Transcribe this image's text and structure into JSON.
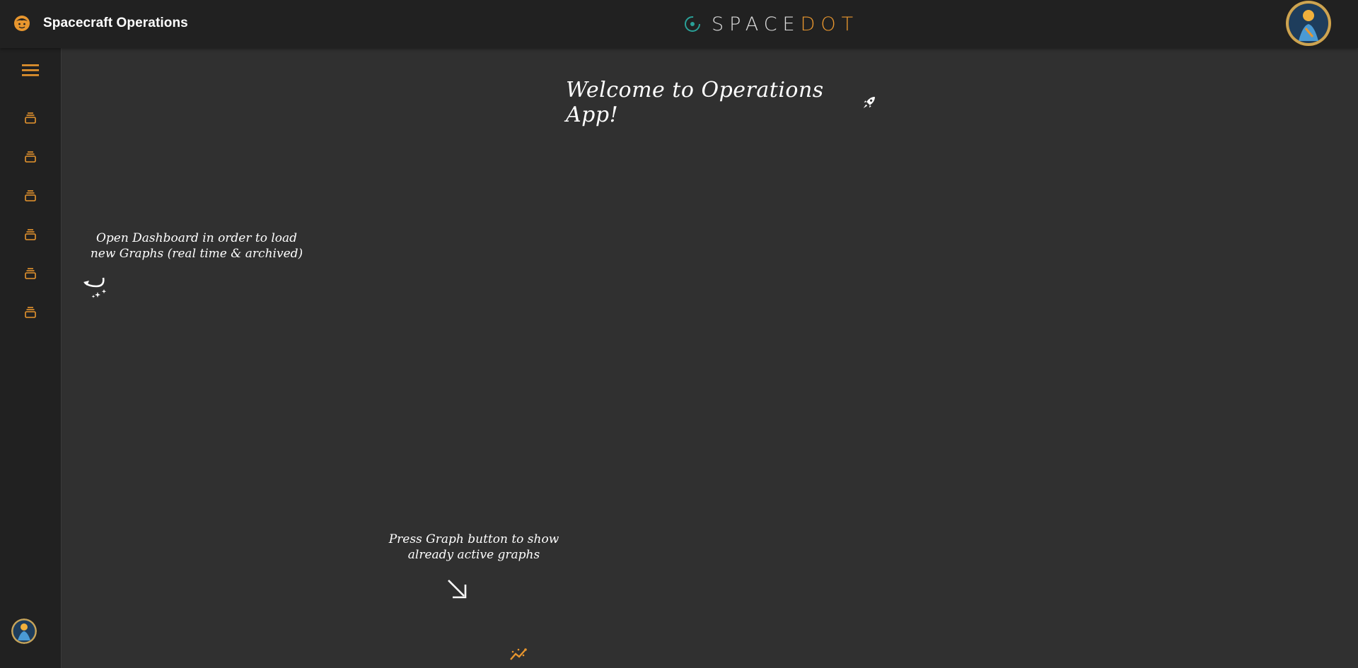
{
  "header": {
    "title": "Spacecraft Operations",
    "brand_space": "SPACE",
    "brand_dot": "DOT",
    "app_icon": "face-icon",
    "profile_icon": "mission-patch-avatar"
  },
  "sidebar": {
    "menu_icon": "hamburger-menu-icon",
    "items": [
      {
        "icon": "dashboard-stack-icon"
      },
      {
        "icon": "dashboard-stack-icon"
      },
      {
        "icon": "dashboard-stack-icon"
      },
      {
        "icon": "dashboard-stack-icon"
      },
      {
        "icon": "dashboard-stack-icon"
      },
      {
        "icon": "dashboard-stack-icon"
      }
    ],
    "avatar_icon": "user-avatar"
  },
  "main": {
    "welcome": "Welcome to Operations App!",
    "hint_dashboard_line1": "Open Dashboard in order to load",
    "hint_dashboard_line2": "new Graphs (real time & archived)",
    "hint_graph_line1": "Press Graph button to show",
    "hint_graph_line2": "already active graphs",
    "graph_button_icon": "graph-icon"
  },
  "colors": {
    "accent": "#e8962e",
    "background": "#303030",
    "bar": "#212121",
    "brand_ring": "#2aa198"
  }
}
